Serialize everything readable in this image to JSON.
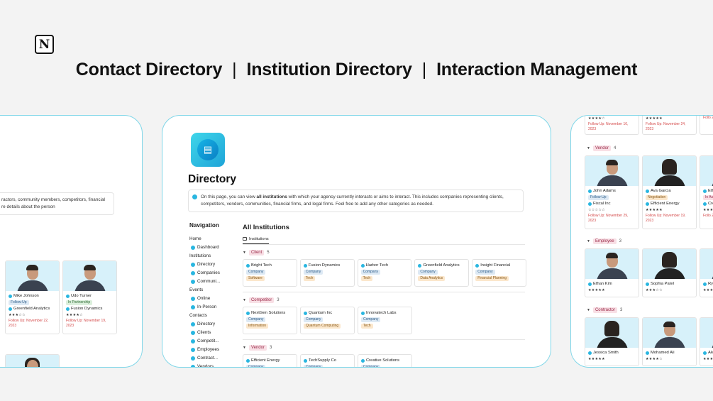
{
  "logo_glyph": "N",
  "headline": [
    "Contact Directory",
    "Institution Directory",
    "Interaction Management"
  ],
  "headline_sep": "|",
  "left_card": {
    "desc_lines": [
      "ractors, community members, competitors, financial",
      "re details about the person"
    ],
    "people": [
      {
        "name": "Mike Johnson",
        "tag": "Follow-Up",
        "org": "Greenfield Analytics",
        "stars": "★★★☆☆",
        "follow_up": "Follow Up: November 22, 2023"
      },
      {
        "name": "Udo Turner",
        "tag": "In Partnership",
        "org": "Fusion Dynamics",
        "stars": "★★★★☆",
        "follow_up": "Follow Up: November 19, 2023"
      }
    ]
  },
  "center_card": {
    "page_title": "Directory",
    "callout_prefix": "On this page, you can view ",
    "callout_bold": "all institutions",
    "callout_rest": " with which your agency currently interacts or aims to interact. This includes companies representing clients, competitors, vendors, communities, financial firms, and legal firms. Feel free to add any other categories as needed.",
    "nav": {
      "title": "Navigation",
      "rows": [
        {
          "label": "Home",
          "kind": "head"
        },
        {
          "label": "Dashboard",
          "kind": "sub"
        },
        {
          "label": "Institutions",
          "kind": "head"
        },
        {
          "label": "Directory",
          "kind": "sub"
        },
        {
          "label": "Companies",
          "kind": "sub"
        },
        {
          "label": "Communi...",
          "kind": "sub"
        },
        {
          "label": "Events",
          "kind": "head"
        },
        {
          "label": "Online",
          "kind": "sub"
        },
        {
          "label": "In-Person",
          "kind": "sub"
        },
        {
          "label": "Contacts",
          "kind": "head"
        },
        {
          "label": "Directory",
          "kind": "sub"
        },
        {
          "label": "Clients",
          "kind": "sub"
        },
        {
          "label": "Competit...",
          "kind": "sub"
        },
        {
          "label": "Employees",
          "kind": "sub"
        },
        {
          "label": "Contract...",
          "kind": "sub"
        },
        {
          "label": "Vendors",
          "kind": "sub"
        }
      ]
    },
    "main_title": "All Institutions",
    "view_tab": "Institutions",
    "groups": [
      {
        "name": "Client",
        "count": "5",
        "items": [
          {
            "name": "Bright Tech",
            "type": "Company",
            "sector": "Software"
          },
          {
            "name": "Fusion Dynamics",
            "type": "Company",
            "sector": "Tech"
          },
          {
            "name": "Harbor Tech",
            "type": "Company",
            "sector": "Tech"
          },
          {
            "name": "Greenfield Analytics",
            "type": "Company",
            "sector": "Data Analytics"
          },
          {
            "name": "Insight Financial",
            "type": "Company",
            "sector": "Financial Planning"
          }
        ]
      },
      {
        "name": "Competitor",
        "count": "3",
        "items": [
          {
            "name": "NextGen Solutions",
            "type": "Company",
            "sector": "Information"
          },
          {
            "name": "Quantum Inc",
            "type": "Company",
            "sector": "Quantum Computing"
          },
          {
            "name": "Innovatech Labs",
            "type": "Company",
            "sector": "Tech"
          }
        ]
      },
      {
        "name": "Vendor",
        "count": "3",
        "items": [
          {
            "name": "Efficient Energy",
            "type": "Company",
            "sector": ""
          },
          {
            "name": "TechSupply Co",
            "type": "Company",
            "sector": ""
          },
          {
            "name": "Creative Solutions",
            "type": "Company",
            "sector": ""
          }
        ]
      }
    ]
  },
  "right_card": {
    "top_row": [
      {
        "stars": "★★★★☆",
        "follow_up": "Follow Up: November 16, 2023"
      },
      {
        "stars": "★★★★★",
        "follow_up": "Follow Up: November 24, 2023"
      },
      {
        "stars": "",
        "follow_up": "Follo 2023"
      }
    ],
    "vendor": {
      "name": "Vendor",
      "count": "4",
      "people": [
        {
          "name": "John Adams",
          "tag": "Follow-Up",
          "org": "Fiscal Inc",
          "stars": "☆☆☆☆☆",
          "follow_up": "Follow Up: November 29, 2023"
        },
        {
          "name": "Ava Garcia",
          "tag": "Negotiation",
          "org": "Efficient Energy",
          "stars": "★★★★★",
          "follow_up": "Follow Up: November 19, 2023"
        },
        {
          "name": "Eth",
          "tag": "In Ass",
          "org": "Cre",
          "stars": "★★★",
          "follow_up": "Follo 2023"
        }
      ]
    },
    "employee": {
      "name": "Employee",
      "count": "3",
      "people": [
        {
          "name": "Ethan Kim",
          "stars": "★★★★★"
        },
        {
          "name": "Sophia Patel",
          "stars": "★★★☆☆"
        },
        {
          "name": "Rya",
          "stars": "★★★"
        }
      ]
    },
    "contractor": {
      "name": "Contractor",
      "count": "3",
      "people": [
        {
          "name": "Jessica Smith",
          "stars": "★★★★★"
        },
        {
          "name": "Mohamed Ali",
          "stars": "★★★★☆"
        },
        {
          "name": "Ale",
          "stars": "★★★"
        }
      ]
    }
  },
  "colors": {
    "accent": "#29b6e0",
    "card_border": "#7fd6e8",
    "tag_pink": "#f8dfe5"
  }
}
